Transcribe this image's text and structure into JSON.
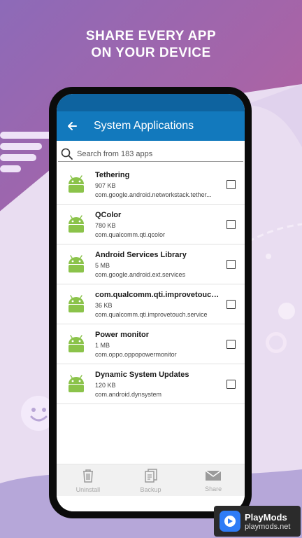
{
  "headline": {
    "line1": "SHARE EVERY APP",
    "line2": "ON YOUR DEVICE"
  },
  "toolbar": {
    "title": "System Applications",
    "back_icon": "arrow-back-icon"
  },
  "search": {
    "placeholder": "Search from 183 apps",
    "value": ""
  },
  "apps": [
    {
      "name": "Tethering",
      "size": "907 KB",
      "package": "com.google.android.networkstack.tether...",
      "checked": false
    },
    {
      "name": "QColor",
      "size": "780 KB",
      "package": "com.qualcomm.qti.qcolor",
      "checked": false
    },
    {
      "name": "Android Services Library",
      "size": "5 MB",
      "package": "com.google.android.ext.services",
      "checked": false
    },
    {
      "name": "com.qualcomm.qti.improvetouch....",
      "size": "36 KB",
      "package": "com.qualcomm.qti.improvetouch.service",
      "checked": false
    },
    {
      "name": "Power monitor",
      "size": "1 MB",
      "package": "com.oppo.oppopowermonitor",
      "checked": false
    },
    {
      "name": "Dynamic System Updates",
      "size": "120 KB",
      "package": "com.android.dynsystem",
      "checked": false
    }
  ],
  "bottom_bar": {
    "uninstall": "Uninstall",
    "backup": "Backup",
    "share": "Share"
  },
  "watermark": {
    "title": "PlayMods",
    "url": "playmods.net"
  },
  "colors": {
    "toolbar": "#1279bd",
    "status_bar": "#0e639f",
    "android_green": "#8bc34a"
  }
}
